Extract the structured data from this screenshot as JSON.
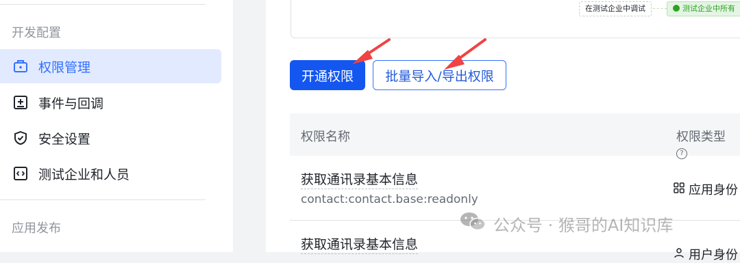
{
  "sidebar": {
    "sections": [
      {
        "label": "开发配置"
      },
      {
        "label": "应用发布"
      }
    ],
    "items": [
      {
        "label": "权限管理",
        "icon": "permission-briefcase-icon",
        "active": true
      },
      {
        "label": "事件与回调",
        "icon": "event-plus-icon",
        "active": false
      },
      {
        "label": "安全设置",
        "icon": "shield-check-icon",
        "active": false
      },
      {
        "label": "测试企业和人员",
        "icon": "code-brackets-icon",
        "active": false
      }
    ]
  },
  "flow": {
    "step_a": "在测试企业中调试",
    "step_b": "测试企业中所有",
    "step_b_icon": "green-circle-icon"
  },
  "toolbar": {
    "primary_label": "开通权限",
    "secondary_label": "批量导入/导出权限"
  },
  "table": {
    "columns": [
      "权限名称",
      "权限类型"
    ],
    "rows": [
      {
        "title": "获取通讯录基本信息",
        "scope": "contact:contact.base:readonly",
        "type": "应用身份",
        "type_icon": "grid-apps-icon"
      },
      {
        "title": "获取通讯录基本信息",
        "scope": "",
        "type": "用户身份",
        "type_icon": "user-icon"
      }
    ]
  },
  "watermark": {
    "text": "公众号 · 猴哥的AI知识库",
    "icon": "wechat-icon"
  },
  "colors": {
    "primary": "#1456f0",
    "active_bg": "#e1eaff",
    "annotation_arrow": "#f04343"
  }
}
